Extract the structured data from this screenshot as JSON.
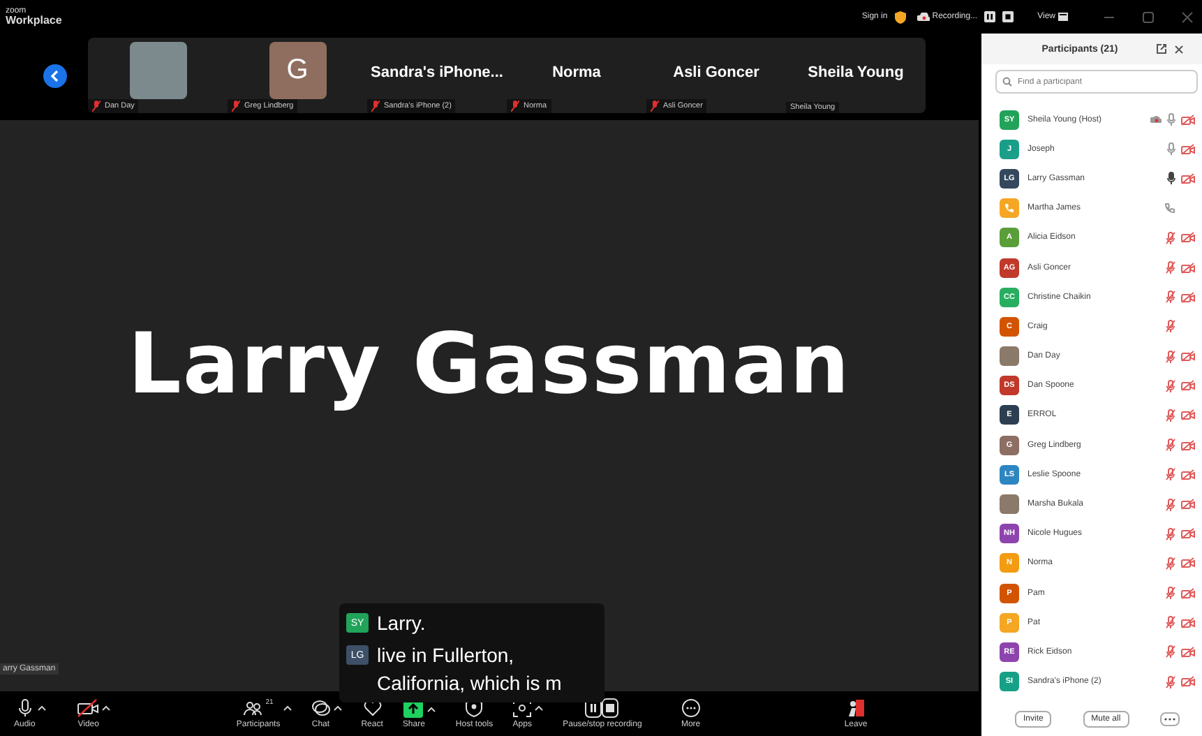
{
  "titlebar": {
    "logo_top": "zoom",
    "logo_bottom": "Workplace",
    "sign_in": "Sign in",
    "recording": "Recording...",
    "view": "View"
  },
  "gallery": [
    {
      "kind": "photo",
      "name": "Dan Day",
      "muted": true
    },
    {
      "kind": "letter",
      "letter": "G",
      "name": "Greg Lindberg",
      "muted": true
    },
    {
      "kind": "name",
      "title": "Sandra's  iPhone...",
      "name": "Sandra's iPhone (2)",
      "muted": true
    },
    {
      "kind": "name",
      "title": "Norma",
      "name": "Norma",
      "muted": true
    },
    {
      "kind": "name",
      "title": "Asli Goncer",
      "name": "Asli Goncer",
      "muted": true
    },
    {
      "kind": "name",
      "title": "Sheila Young",
      "name": "Sheila Young",
      "muted": false
    }
  ],
  "speaker": {
    "name": "Larry Gassman",
    "label": "arry Gassman"
  },
  "captions": [
    {
      "avatar": "SY",
      "color": "#22a35a",
      "text": "Larry."
    },
    {
      "avatar": "LG",
      "color": "#3d5068",
      "text": "live in Fullerton, California, which is m"
    }
  ],
  "toolbar": [
    {
      "kind": "audio",
      "label": "Audio",
      "caret": true
    },
    {
      "kind": "video",
      "label": "Video",
      "caret": true
    },
    {
      "kind": "participants",
      "label": "Participants",
      "count": "21",
      "caret": true
    },
    {
      "kind": "chat",
      "label": "Chat",
      "caret": true
    },
    {
      "kind": "react",
      "label": "React",
      "caret": false
    },
    {
      "kind": "share",
      "label": "Share",
      "caret": true
    },
    {
      "kind": "host",
      "label": "Host tools",
      "caret": false
    },
    {
      "kind": "apps",
      "label": "Apps",
      "caret": true
    },
    {
      "kind": "record",
      "label": "Pause/stop recording",
      "caret": false
    },
    {
      "kind": "more",
      "label": "More",
      "caret": false
    },
    {
      "kind": "leave",
      "label": "Leave",
      "caret": false
    }
  ],
  "panel": {
    "title": "Participants (21)",
    "search": {
      "placeholder": "Find a participant"
    },
    "participants": [
      {
        "kind": "initials",
        "avatar": "SY",
        "color": "#22a35a",
        "name": "Sheila Young (Host)",
        "recording": true,
        "muted": false,
        "speaking": false,
        "video_off": true
      },
      {
        "kind": "initials",
        "avatar": "J",
        "color": "#1a9e8a",
        "name": "Joseph",
        "recording": false,
        "muted": false,
        "speaking": false,
        "video_off": true
      },
      {
        "kind": "initials",
        "avatar": "LG",
        "color": "#34495e",
        "name": "Larry Gassman",
        "recording": false,
        "muted": false,
        "speaking": true,
        "video_off": true
      },
      {
        "kind": "phone",
        "color": "#f5a623",
        "name": "Martha James",
        "recording": false,
        "muted": false,
        "speaking": false,
        "video_off": false
      },
      {
        "kind": "initials",
        "avatar": "A",
        "color": "#5a9e3a",
        "name": "Alicia Eidson",
        "recording": false,
        "muted": true,
        "speaking": false,
        "video_off": true
      },
      {
        "kind": "initials",
        "avatar": "AG",
        "color": "#c0392b",
        "name": "Asli Goncer",
        "recording": false,
        "muted": true,
        "speaking": false,
        "video_off": true
      },
      {
        "kind": "initials",
        "avatar": "CC",
        "color": "#27ae60",
        "name": "Christine Chaikin",
        "recording": false,
        "muted": true,
        "speaking": false,
        "video_off": true
      },
      {
        "kind": "initials",
        "avatar": "C",
        "color": "#d35400",
        "name": "Craig",
        "recording": false,
        "muted": true,
        "speaking": false,
        "video_off": false
      },
      {
        "kind": "photo",
        "name": "Dan Day",
        "recording": false,
        "muted": true,
        "speaking": false,
        "video_off": true
      },
      {
        "kind": "initials",
        "avatar": "DS",
        "color": "#c0392b",
        "name": "Dan Spoone",
        "recording": false,
        "muted": true,
        "speaking": false,
        "video_off": true
      },
      {
        "kind": "initials",
        "avatar": "E",
        "color": "#2c3e50",
        "name": "ERROL",
        "recording": false,
        "muted": true,
        "speaking": false,
        "video_off": true
      },
      {
        "kind": "initials",
        "avatar": "G",
        "color": "#8d6e63",
        "name": "Greg Lindberg",
        "recording": false,
        "muted": true,
        "speaking": false,
        "video_off": true
      },
      {
        "kind": "initials",
        "avatar": "LS",
        "color": "#2e86c1",
        "name": "Leslie Spoone",
        "recording": false,
        "muted": true,
        "speaking": false,
        "video_off": true
      },
      {
        "kind": "photo",
        "name": "Marsha Bukala",
        "recording": false,
        "muted": true,
        "speaking": false,
        "video_off": true
      },
      {
        "kind": "initials",
        "avatar": "NH",
        "color": "#8e44ad",
        "name": "Nicole Hugues",
        "recording": false,
        "muted": true,
        "speaking": false,
        "video_off": true
      },
      {
        "kind": "initials",
        "avatar": "N",
        "color": "#f39c12",
        "name": "Norma",
        "recording": false,
        "muted": true,
        "speaking": false,
        "video_off": true
      },
      {
        "kind": "initials",
        "avatar": "P",
        "color": "#d35400",
        "name": "Pam",
        "recording": false,
        "muted": true,
        "speaking": false,
        "video_off": true
      },
      {
        "kind": "initials",
        "avatar": "P",
        "color": "#f5a623",
        "name": "Pat",
        "recording": false,
        "muted": true,
        "speaking": false,
        "video_off": true
      },
      {
        "kind": "initials",
        "avatar": "RE",
        "color": "#8e44ad",
        "name": "Rick Eidson",
        "recording": false,
        "muted": true,
        "speaking": false,
        "video_off": true
      },
      {
        "kind": "initials",
        "avatar": "SI",
        "color": "#16a085",
        "name": "Sandra's iPhone (2)",
        "recording": false,
        "muted": true,
        "speaking": false,
        "video_off": true
      }
    ],
    "buttons": [
      "Invite",
      "Mute all"
    ]
  }
}
